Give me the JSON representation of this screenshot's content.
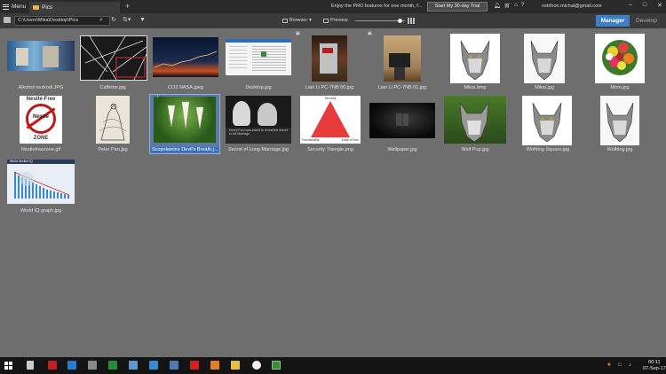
{
  "titlebar": {
    "menu_label": "Menu",
    "tab_label": "Pics",
    "promo_text": "Enjoy the PRO features for one month, f...",
    "trial_button": "Start My 30-day Trial",
    "email": "ostrihon.michal@gmail.com",
    "icons": [
      "bell-icon",
      "cart-icon",
      "home-icon",
      "help-icon"
    ]
  },
  "toolbar": {
    "path": "C:\\Users\\Mika\\Desktop\\Pics",
    "browser_label": "Browser",
    "preview_label": "Preview",
    "zoom_fraction": 0.9,
    "manager_label": "Manager",
    "develop_label": "Develop"
  },
  "files": [
    {
      "name": "Alkohol nezkodi.JPG"
    },
    {
      "name": "Caffeine.jpg"
    },
    {
      "name": "CO2 NASA.jpeg"
    },
    {
      "name": "Desktop.jpg"
    },
    {
      "name": "Lian Li PC-7NB 00.jpg"
    },
    {
      "name": "Lian Li PC-7NB 01.jpg"
    },
    {
      "name": "Mikai.bmp"
    },
    {
      "name": "Mikai.jpg"
    },
    {
      "name": "Mom.jpg"
    },
    {
      "name": "Nestlefreezone.gif"
    },
    {
      "name": "Peter Pan.jpg"
    },
    {
      "name": "Scopolamine  Devil's Breath.j..."
    },
    {
      "name": "Secret of Long Marriage.jpg"
    },
    {
      "name": "Security Triangle.png"
    },
    {
      "name": "Wallpaper.jpg"
    },
    {
      "name": "Wolf Pup.jpg"
    },
    {
      "name": "Wolfdog Square.jpg"
    },
    {
      "name": "Wolfdog.jpg"
    },
    {
      "name": "World IQ graph.jpg"
    }
  ],
  "thumb_text": {
    "nestle_top": "Nestlé-Free",
    "nestle_mid": "Nestle",
    "nestle_bottom": "ZONE",
    "secret_quote": "Henry Ford was asked to reveal the secret to his Marriage.",
    "security_title": "Security",
    "security_left": "Functionality",
    "security_right": "Ease of Use",
    "iq_title": "World decline IQ"
  },
  "taskbar": {
    "time": "00:11",
    "date": "07-Sep-17"
  },
  "colors": {
    "accent": "#3d7fc4",
    "background": "#6e6e6e",
    "titlebar": "#2a2a2a",
    "toolbar": "#3a3a3a",
    "taskbar": "#141414"
  }
}
